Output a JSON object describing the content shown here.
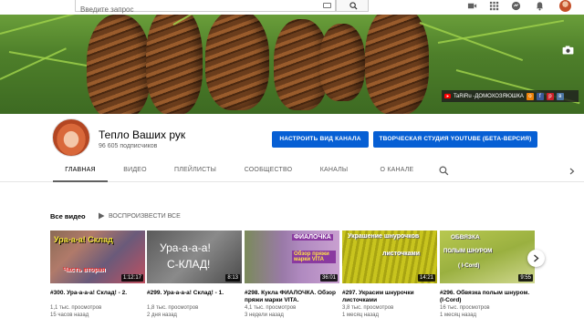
{
  "search": {
    "placeholder": "Введите запрос"
  },
  "banner": {
    "site_label": "TaRiRu -ДОМОХОЗЯЮШКА",
    "social": [
      "ok-icon",
      "facebook-icon",
      "pinterest-icon",
      "vk-icon"
    ]
  },
  "channel": {
    "title": "Тепло Ваших рук",
    "subscribers": "96 605 подписчиков",
    "customize_label": "НАСТРОИТЬ ВИД КАНАЛА",
    "studio_label": "ТВОРЧЕСКАЯ СТУДИЯ YOUTUBE (БЕТА-ВЕРСИЯ)"
  },
  "tabs": [
    "ГЛАВНАЯ",
    "ВИДЕО",
    "ПЛЕЙЛИСТЫ",
    "СООБЩЕСТВО",
    "КАНАЛЫ",
    "О КАНАЛЕ"
  ],
  "section": {
    "title": "Все видео",
    "play_all": "ВОСПРОИЗВЕСТИ ВСЕ"
  },
  "videos": [
    {
      "title": "#300. Ура-а-а-а! Склад! - 2.",
      "views": "1,1 тыс. просмотров",
      "age": "15 часов назад",
      "duration": "1:12:17",
      "thumb_text": "Ура-а-а! Склад",
      "thumb_text2": "Часть вторая"
    },
    {
      "title": "#299. Ура-а-а-а! Склад! - 1.",
      "views": "1,8 тыс. просмотров",
      "age": "2 дня назад",
      "duration": "8:13",
      "thumb_text": "Ура-а-а-а!",
      "thumb_text2": "С-КЛАД!"
    },
    {
      "title": "#298. Кукла ФИАЛОЧКА. Обзор пряжи марки VITA.",
      "views": "4,1 тыс. просмотров",
      "age": "3 недели назад",
      "duration": "36:01",
      "thumb_text": "ФИАЛОЧКА",
      "thumb_text2": "Обзор пряжи марки VITA"
    },
    {
      "title": "#297. Украсим шнурочки листочками",
      "views": "3,8 тыс. просмотров",
      "age": "1 месяц назад",
      "duration": "14:21",
      "thumb_text": "Украшение шнурочков",
      "thumb_text2": "листочками"
    },
    {
      "title": "#296. Обвязка полым шнуром. (I-Cord)",
      "views": "16 тыс. просмотров",
      "age": "1 месяц назад",
      "duration": "9:55",
      "thumb_text": "ОБВЯЗКА",
      "thumb_text2": "ПОЛЫМ ШНУРОМ",
      "thumb_text3": "( I-Cord)"
    }
  ]
}
